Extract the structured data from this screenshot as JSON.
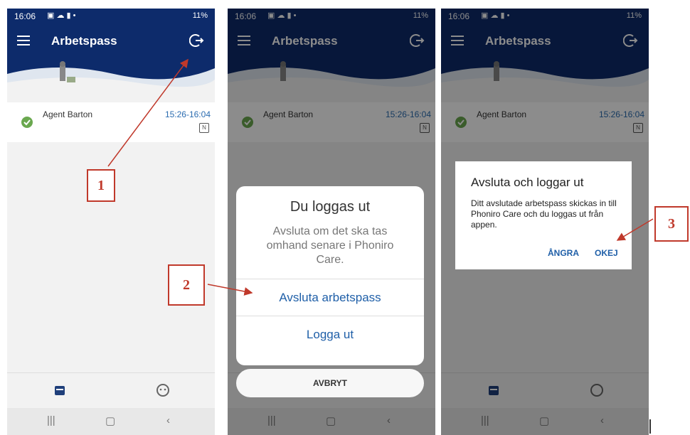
{
  "status": {
    "time": "16:06",
    "battery": "11%"
  },
  "app": {
    "title": "Arbetspass"
  },
  "shift": {
    "agent": "Agent Barton",
    "time_range": "15:26-16:04"
  },
  "sheet": {
    "title": "Du loggas ut",
    "message": "Avsluta om det ska tas omhand senare i Phoniro Care.",
    "end_shift_label": "Avsluta arbetspass",
    "logout_label": "Logga ut",
    "cancel_label": "AVBRYT"
  },
  "dialog": {
    "title": "Avsluta och loggar ut",
    "message": "Ditt avslutade arbetspass skickas in till Phoniro Care och du loggas ut från appen.",
    "cancel_label": "ÅNGRA",
    "ok_label": "OKEJ"
  },
  "callouts": [
    "1",
    "2",
    "3"
  ],
  "icons": [
    "menu-icon",
    "logout-icon",
    "check-icon",
    "nfc-icon",
    "calendar-icon",
    "face-icon"
  ],
  "colors": {
    "appbar": "#0d2b6b",
    "accent": "#1f5fa8",
    "callout": "#c0392b",
    "check": "#6aa84f"
  }
}
